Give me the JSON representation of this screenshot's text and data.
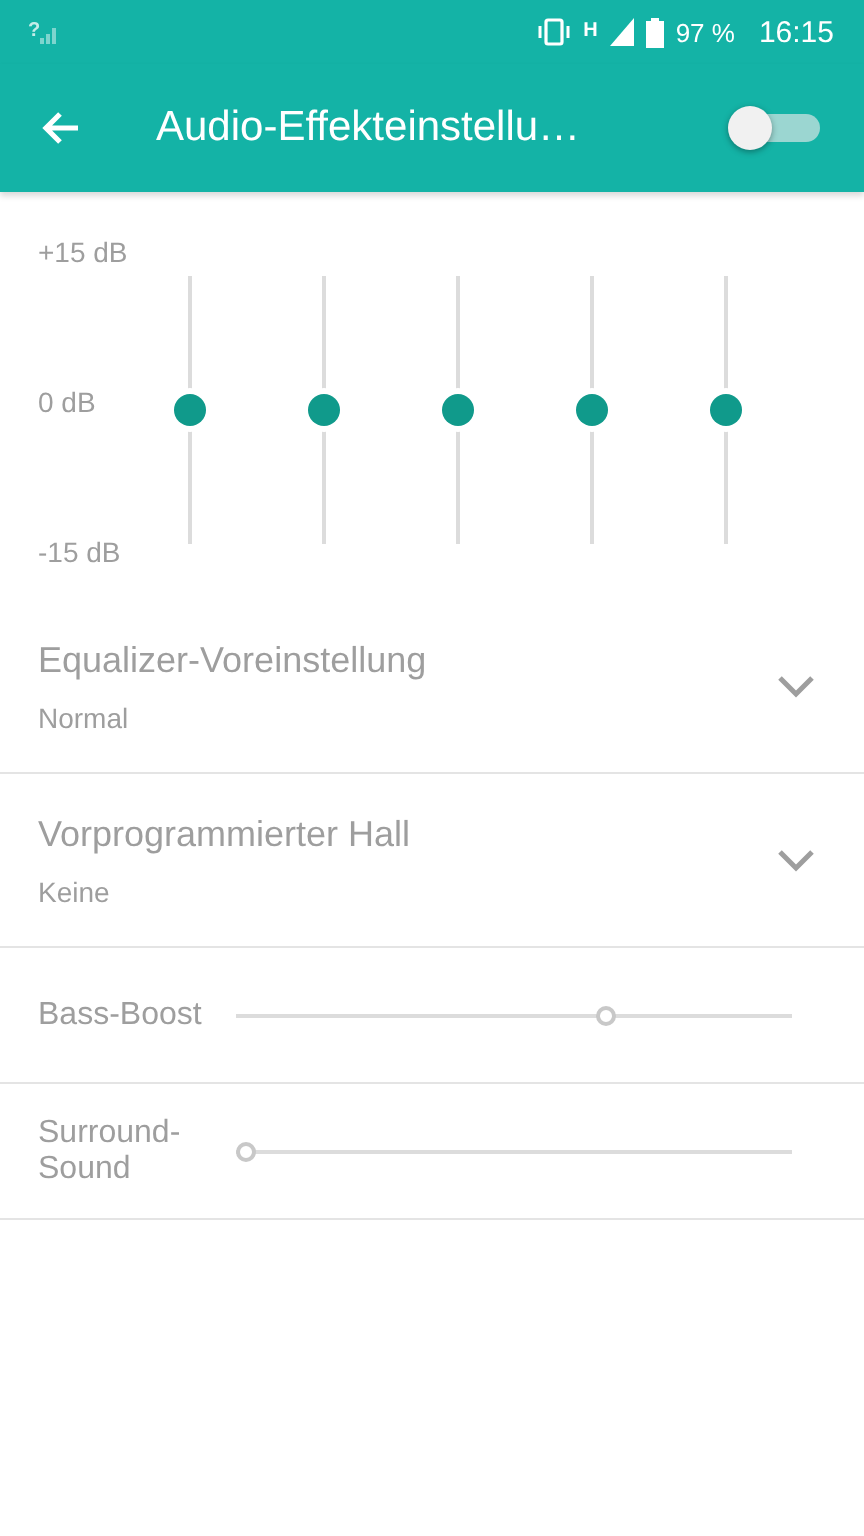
{
  "status_bar": {
    "sim_mark": "?",
    "network_mark": "H",
    "battery": "97 %",
    "time": "16:15"
  },
  "toolbar": {
    "title": "Audio-Effekteinstellu…",
    "effects_on": false
  },
  "equalizer": {
    "scale_labels": [
      "+15 dB",
      "0 dB",
      "-15 dB"
    ],
    "bands": [
      {
        "level": 0.5
      },
      {
        "level": 0.5
      },
      {
        "level": 0.5
      },
      {
        "level": 0.5
      },
      {
        "level": 0.5
      }
    ]
  },
  "settings": [
    {
      "kind": "dropdown",
      "title": "Equalizer-Voreinstellung",
      "value": "Normal"
    },
    {
      "kind": "dropdown",
      "title": "Vorprogrammierter Hall",
      "value": "Keine"
    },
    {
      "kind": "slider",
      "title": "Bass-Boost",
      "level": 0.67
    },
    {
      "kind": "slider",
      "title": "Surround-Sound",
      "level": 0
    }
  ]
}
